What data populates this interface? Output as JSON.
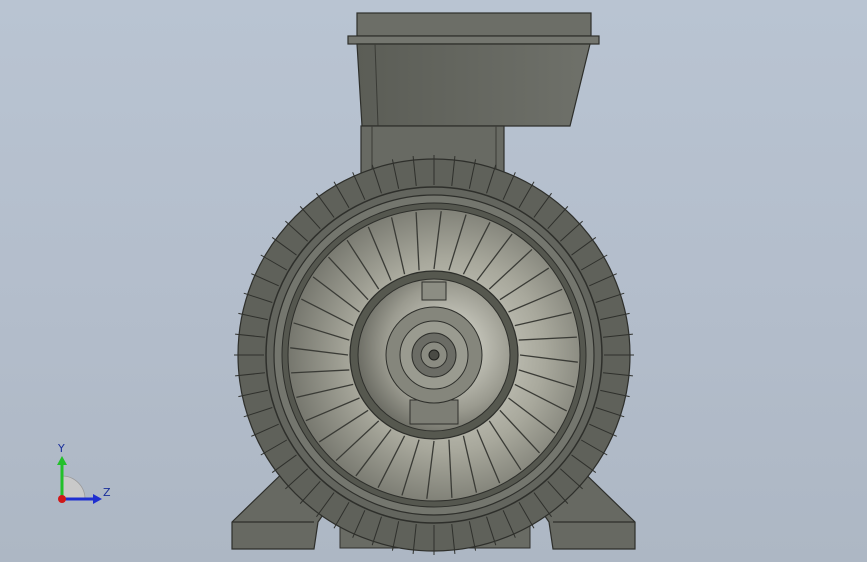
{
  "viewport": {
    "background_top": "#b9c4d2",
    "background_bottom": "#adb7c4"
  },
  "model": {
    "body_color": "#6b6e66",
    "edge_color": "#2e2f2b",
    "fan_count": 36,
    "body_fin_count": 60
  },
  "triad": {
    "y_label": "Y",
    "z_label": "Z",
    "y_color": "#22c02a",
    "z_color": "#1f2fd0",
    "x_color": "#d01818"
  }
}
